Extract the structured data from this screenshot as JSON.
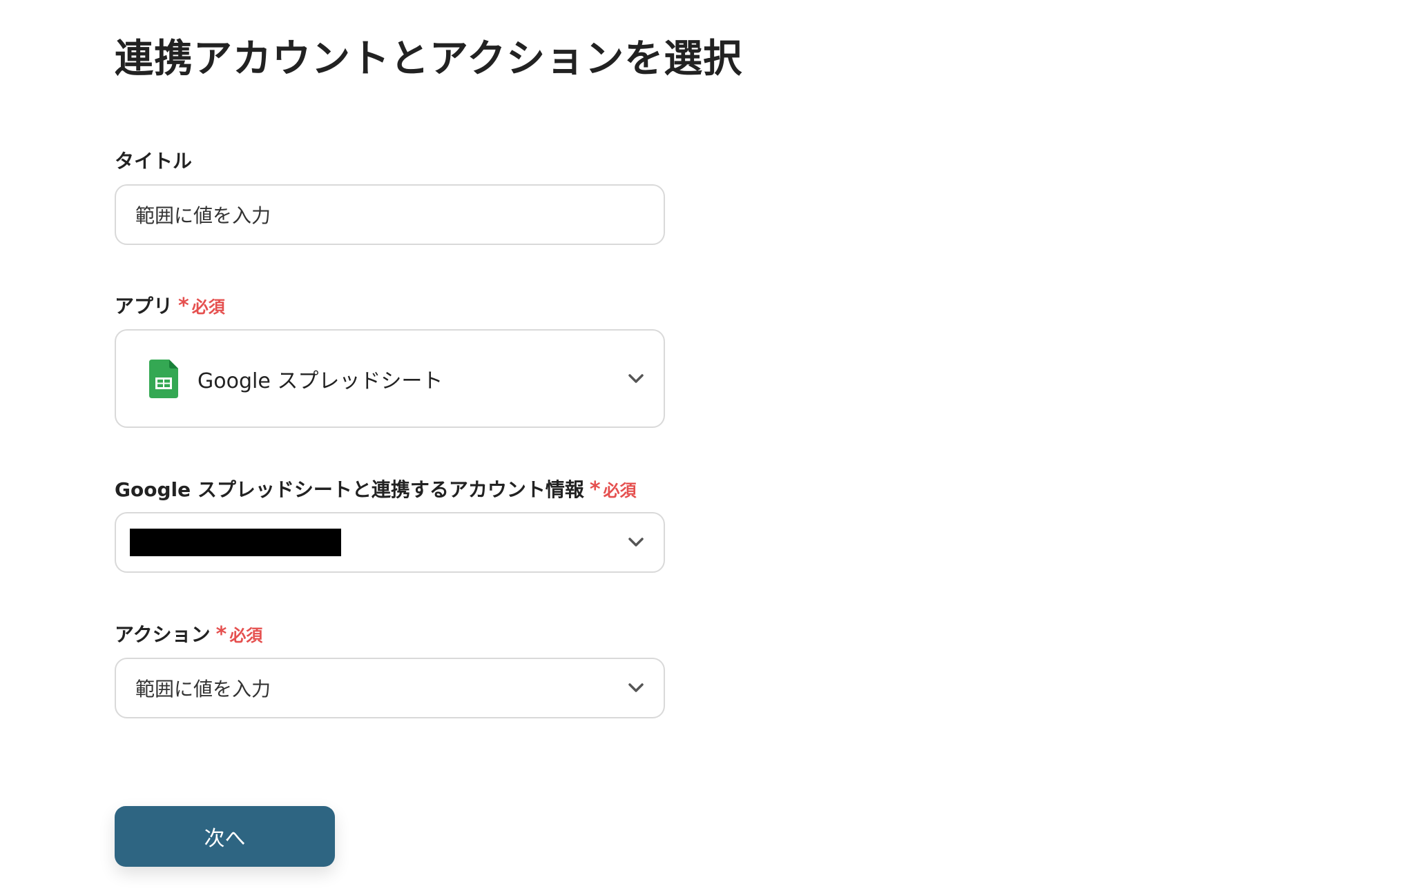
{
  "page": {
    "title": "連携アカウントとアクションを選択"
  },
  "colors": {
    "accent_button": "#2e6582",
    "required": "#e5504f",
    "border": "#d9d9d9",
    "sheets_green": "#34a853"
  },
  "form": {
    "title_field": {
      "label": "タイトル",
      "value": "範囲に値を入力"
    },
    "app_field": {
      "label": "アプリ",
      "required_mark": "*",
      "required_text": "必須",
      "selected_value": "Google スプレッドシート",
      "icon": "google-sheets-icon"
    },
    "account_field": {
      "label": "Google スプレッドシートと連携するアカウント情報",
      "required_mark": "*",
      "required_text": "必須",
      "selected_value_redacted": true
    },
    "action_field": {
      "label": "アクション",
      "required_mark": "*",
      "required_text": "必須",
      "selected_value": "範囲に値を入力"
    }
  },
  "actions": {
    "next_label": "次へ"
  },
  "icons": {
    "dropdown": "chevron-down-icon"
  }
}
